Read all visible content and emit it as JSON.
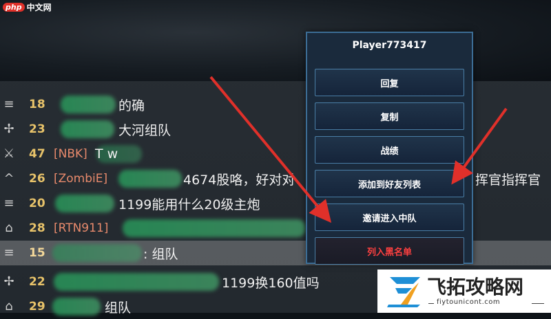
{
  "php_logo": {
    "badge": "php",
    "text": "中文网"
  },
  "chat_rows": [
    {
      "icon": "rank-chevron-icon",
      "icon_glyph": "≡",
      "level": "18",
      "clan": "",
      "message": "的确",
      "selected": false
    },
    {
      "icon": "rank-wings-icon",
      "icon_glyph": "✢",
      "level": "23",
      "clan": "",
      "message": "大河组队",
      "selected": false
    },
    {
      "icon": "rank-wings-icon",
      "icon_glyph": "⚔",
      "level": "47",
      "clan": "[NBK]",
      "message": "T        w",
      "selected": false
    },
    {
      "icon": "rank-caret-icon",
      "icon_glyph": "^",
      "level": "26",
      "clan": "[ZombiE]",
      "message": "4674股咯，好对对",
      "message2": "挥官指挥官",
      "selected": false
    },
    {
      "icon": "rank-chevron-icon",
      "icon_glyph": "≡",
      "level": "20",
      "clan": "",
      "message": "1199能用什么20级主炮",
      "selected": false
    },
    {
      "icon": "rank-caret-icon",
      "icon_glyph": "⌂",
      "level": "28",
      "clan": "[RTN911]",
      "message": "",
      "selected": false
    },
    {
      "icon": "rank-chevron-icon",
      "icon_glyph": "≡",
      "level": "15",
      "clan": "",
      "message": ": 组队",
      "selected": true
    },
    {
      "icon": "rank-wings-icon",
      "icon_glyph": "✢",
      "level": "22",
      "clan": "",
      "message": "1199换160值吗",
      "selected": false
    },
    {
      "icon": "rank-caret-icon",
      "icon_glyph": "⌂",
      "level": "29",
      "clan": "",
      "message": "组队",
      "selected": false
    }
  ],
  "menu": {
    "title": "Player773417",
    "items": [
      {
        "label": "回复",
        "danger": false
      },
      {
        "label": "复制",
        "danger": false
      },
      {
        "label": "战绩",
        "danger": false
      },
      {
        "label": "添加到好友列表",
        "danger": false
      },
      {
        "label": "邀请进入中队",
        "danger": false
      },
      {
        "label": "列入黑名单",
        "danger": true
      }
    ]
  },
  "colors": {
    "arrow": "#e0302a",
    "menu_border": "#4a7ea6",
    "danger": "#ff4040",
    "level": "#e8c36a"
  },
  "watermark": {
    "title": "飞拓攻略网",
    "url": "fiytounicont.com"
  }
}
